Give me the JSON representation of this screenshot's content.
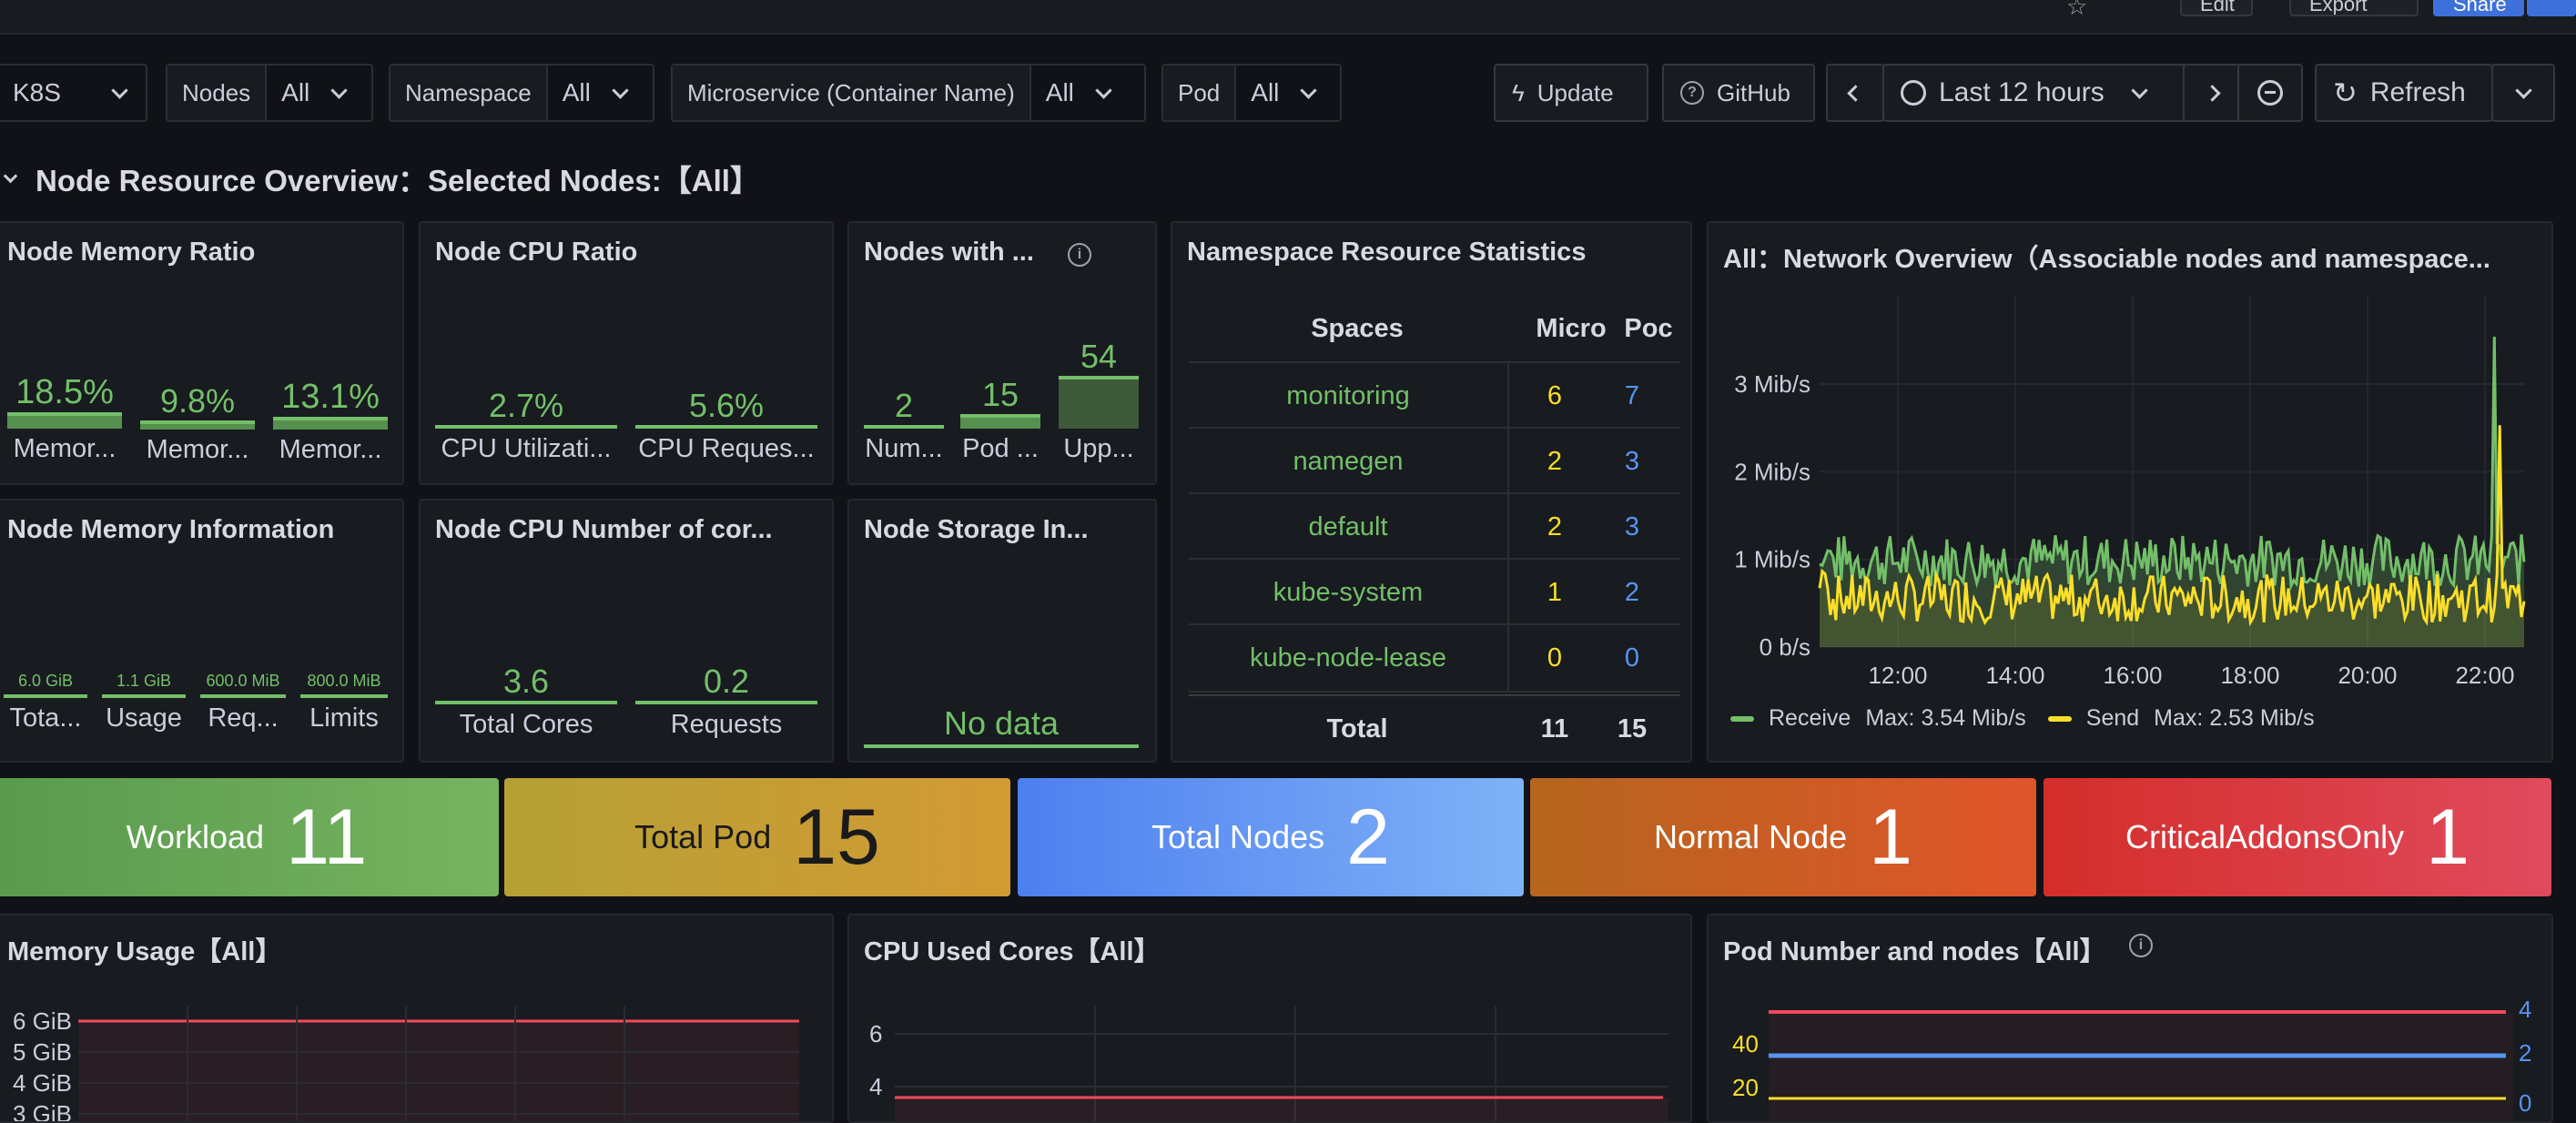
{
  "topbar": {
    "edit_label": "Edit",
    "export_label": "Export",
    "share_label": "Share"
  },
  "filters": {
    "k8s_label": "K8S",
    "nodes_label": "Nodes",
    "nodes_value": "All",
    "namespace_label": "Namespace",
    "namespace_value": "All",
    "microservice_label": "Microservice (Container Name)",
    "microservice_value": "All",
    "pod_label": "Pod",
    "pod_value": "All"
  },
  "toolbar": {
    "update_label": "Update",
    "github_label": "GitHub",
    "time_range": "Last 12 hours",
    "refresh_label": "Refresh"
  },
  "row": {
    "title": "Node Resource Overview：Selected Nodes:【All】"
  },
  "panels": {
    "memory_ratio": {
      "title": "Node Memory Ratio",
      "stats": [
        {
          "value": "18.5%",
          "label": "Memor...",
          "fill": 0.185
        },
        {
          "value": "9.8%",
          "label": "Memor...",
          "fill": 0.098
        },
        {
          "value": "13.1%",
          "label": "Memor...",
          "fill": 0.131
        }
      ]
    },
    "cpu_ratio": {
      "title": "Node CPU Ratio",
      "stats": [
        {
          "value": "2.7%",
          "label": "CPU Utilizati..."
        },
        {
          "value": "5.6%",
          "label": "CPU Reques..."
        }
      ]
    },
    "nodes_with": {
      "title": "Nodes with ...",
      "stats": [
        {
          "value": "2",
          "label": "Num..."
        },
        {
          "value": "15",
          "label": "Pod ..."
        },
        {
          "value": "54",
          "label": "Upp..."
        }
      ]
    },
    "memory_info": {
      "title": "Node Memory Information",
      "stats": [
        {
          "value": "6.0 GiB",
          "label": "Tota..."
        },
        {
          "value": "1.1 GiB",
          "label": "Usage"
        },
        {
          "value": "600.0 MiB",
          "label": "Req..."
        },
        {
          "value": "800.0 MiB",
          "label": "Limits"
        }
      ]
    },
    "cpu_cores": {
      "title": "Node CPU Number of cor...",
      "stats": [
        {
          "value": "3.6",
          "label": "Total Cores"
        },
        {
          "value": "0.2",
          "label": "Requests"
        }
      ]
    },
    "storage": {
      "title": "Node Storage In...",
      "no_data": "No data"
    },
    "namespace_stats": {
      "title": "Namespace Resource Statistics",
      "headers": [
        "Spaces",
        "Micro",
        "Poc"
      ],
      "rows": [
        {
          "space": "monitoring",
          "micro": "6",
          "pods": "7"
        },
        {
          "space": "namegen",
          "micro": "2",
          "pods": "3"
        },
        {
          "space": "default",
          "micro": "2",
          "pods": "3"
        },
        {
          "space": "kube-system",
          "micro": "1",
          "pods": "2"
        },
        {
          "space": "kube-node-lease",
          "micro": "0",
          "pods": "0"
        }
      ],
      "total": {
        "label": "Total",
        "micro": "11",
        "pods": "15"
      }
    },
    "network": {
      "title": "All：Network Overview（Associable nodes and namespace...",
      "legend": [
        {
          "name": "Receive",
          "max": "Max: 3.54 Mib/s",
          "color": "#73bf69"
        },
        {
          "name": "Send",
          "max": "Max: 2.53 Mib/s",
          "color": "#fade2a"
        }
      ]
    }
  },
  "banners": [
    {
      "label": "Workload",
      "value": "11"
    },
    {
      "label": "Total Pod",
      "value": "15"
    },
    {
      "label": "Total Nodes",
      "value": "2"
    },
    {
      "label": "Normal Node",
      "value": "1"
    },
    {
      "label": "CriticalAddonsOnly",
      "value": "1"
    }
  ],
  "bottom": {
    "memory_usage_title": "Memory Usage【All】",
    "cpu_used_title": "CPU Used Cores【All】",
    "pod_number_title": "Pod Number and nodes【All】"
  },
  "chart_data": [
    {
      "type": "line",
      "title": "All：Network Overview（Associable nodes and namespace...",
      "x_ticks": [
        "12:00",
        "14:00",
        "16:00",
        "18:00",
        "20:00",
        "22:00"
      ],
      "y_ticks": [
        "0 b/s",
        "1 Mib/s",
        "2 Mib/s",
        "3 Mib/s"
      ],
      "ylim": [
        0,
        3.8
      ],
      "xlim": [
        "10:40",
        "22:40"
      ],
      "series": [
        {
          "name": "Receive",
          "color": "#73bf69",
          "max": 3.54,
          "baseline": 0.9,
          "spike_at": "22:10"
        },
        {
          "name": "Send",
          "color": "#fade2a",
          "max": 2.53,
          "baseline": 0.5,
          "spike_at": "22:15"
        }
      ]
    },
    {
      "type": "line",
      "title": "Memory Usage【All】",
      "y_ticks": [
        "3 GiB",
        "4 GiB",
        "5 GiB",
        "6 GiB"
      ],
      "series": [
        {
          "color": "#f2495c",
          "values": [
            6.0,
            6.0
          ]
        }
      ]
    },
    {
      "type": "line",
      "title": "CPU Used Cores【All】",
      "y_ticks": [
        "4",
        "6"
      ],
      "series": [
        {
          "color": "#f2495c",
          "values": [
            3.6,
            3.6
          ]
        }
      ]
    },
    {
      "type": "line",
      "title": "Pod Number and nodes【All】",
      "y_ticks_left": [
        "20",
        "40"
      ],
      "y_ticks_right": [
        "0",
        "2",
        "4"
      ],
      "series": [
        {
          "color": "#f2495c",
          "axis": "right",
          "values": [
            4,
            4
          ]
        },
        {
          "color": "#5794f2",
          "axis": "right",
          "values": [
            2,
            2
          ]
        },
        {
          "color": "#fade2a",
          "axis": "left",
          "values": [
            15,
            15
          ]
        }
      ]
    }
  ]
}
